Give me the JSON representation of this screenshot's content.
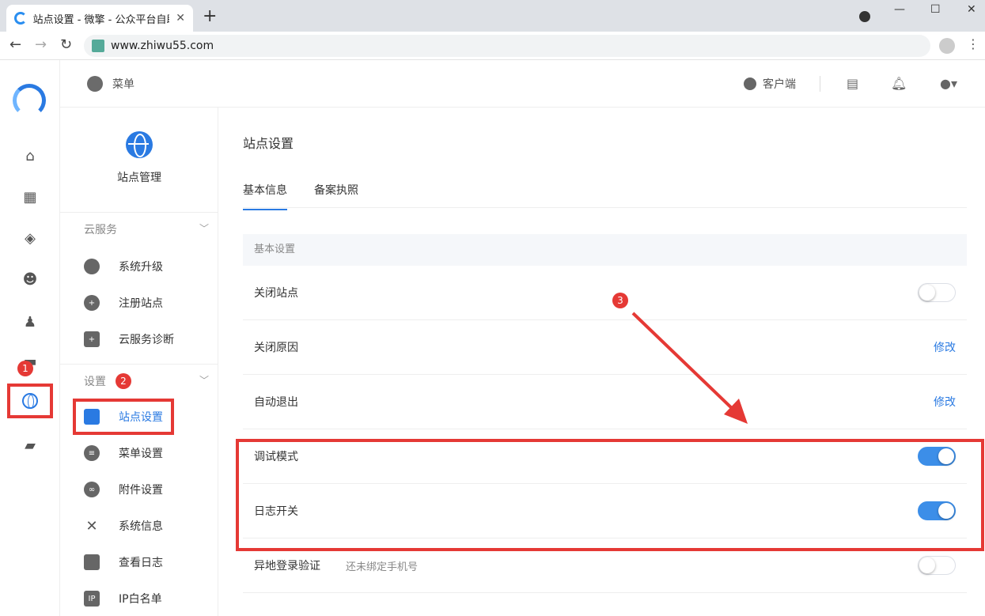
{
  "browser": {
    "tab_title": "站点设置 - 微擎 - 公众平台自助引擎",
    "tab_close": "✕",
    "new_tab": "+",
    "url": "www.zhiwu55.com",
    "win_min": "—",
    "win_max": "☐",
    "win_close": "✕"
  },
  "topbar": {
    "menu_label": "菜单",
    "client_label": "客户端"
  },
  "rail": {
    "badge1": "1"
  },
  "subnav": {
    "header": "站点管理",
    "group_cloud": "云服务",
    "cloud_items": [
      "系统升级",
      "注册站点",
      "云服务诊断"
    ],
    "group_settings": "设置",
    "badge2": "2",
    "settings_items": [
      "站点设置",
      "菜单设置",
      "附件设置",
      "系统信息",
      "查看日志",
      "IP白名单"
    ],
    "ip_icon_text": "IP"
  },
  "main": {
    "page_title": "站点设置",
    "tabs": [
      "基本信息",
      "备案执照"
    ],
    "section": "基本设置",
    "rows": [
      {
        "label": "关闭站点",
        "control": "toggle",
        "on": false
      },
      {
        "label": "关闭原因",
        "control": "edit",
        "action": "修改"
      },
      {
        "label": "自动退出",
        "control": "edit",
        "action": "修改"
      },
      {
        "label": "调试模式",
        "control": "toggle",
        "on": true
      },
      {
        "label": "日志开关",
        "control": "toggle",
        "on": true
      },
      {
        "label": "异地登录验证",
        "hint": "还未绑定手机号",
        "control": "toggle",
        "on": false
      }
    ],
    "badge3": "3"
  },
  "colors": {
    "accent": "#2a7ae2",
    "toggle_on": "#3c8ee8",
    "annotation_red": "#e53935"
  }
}
